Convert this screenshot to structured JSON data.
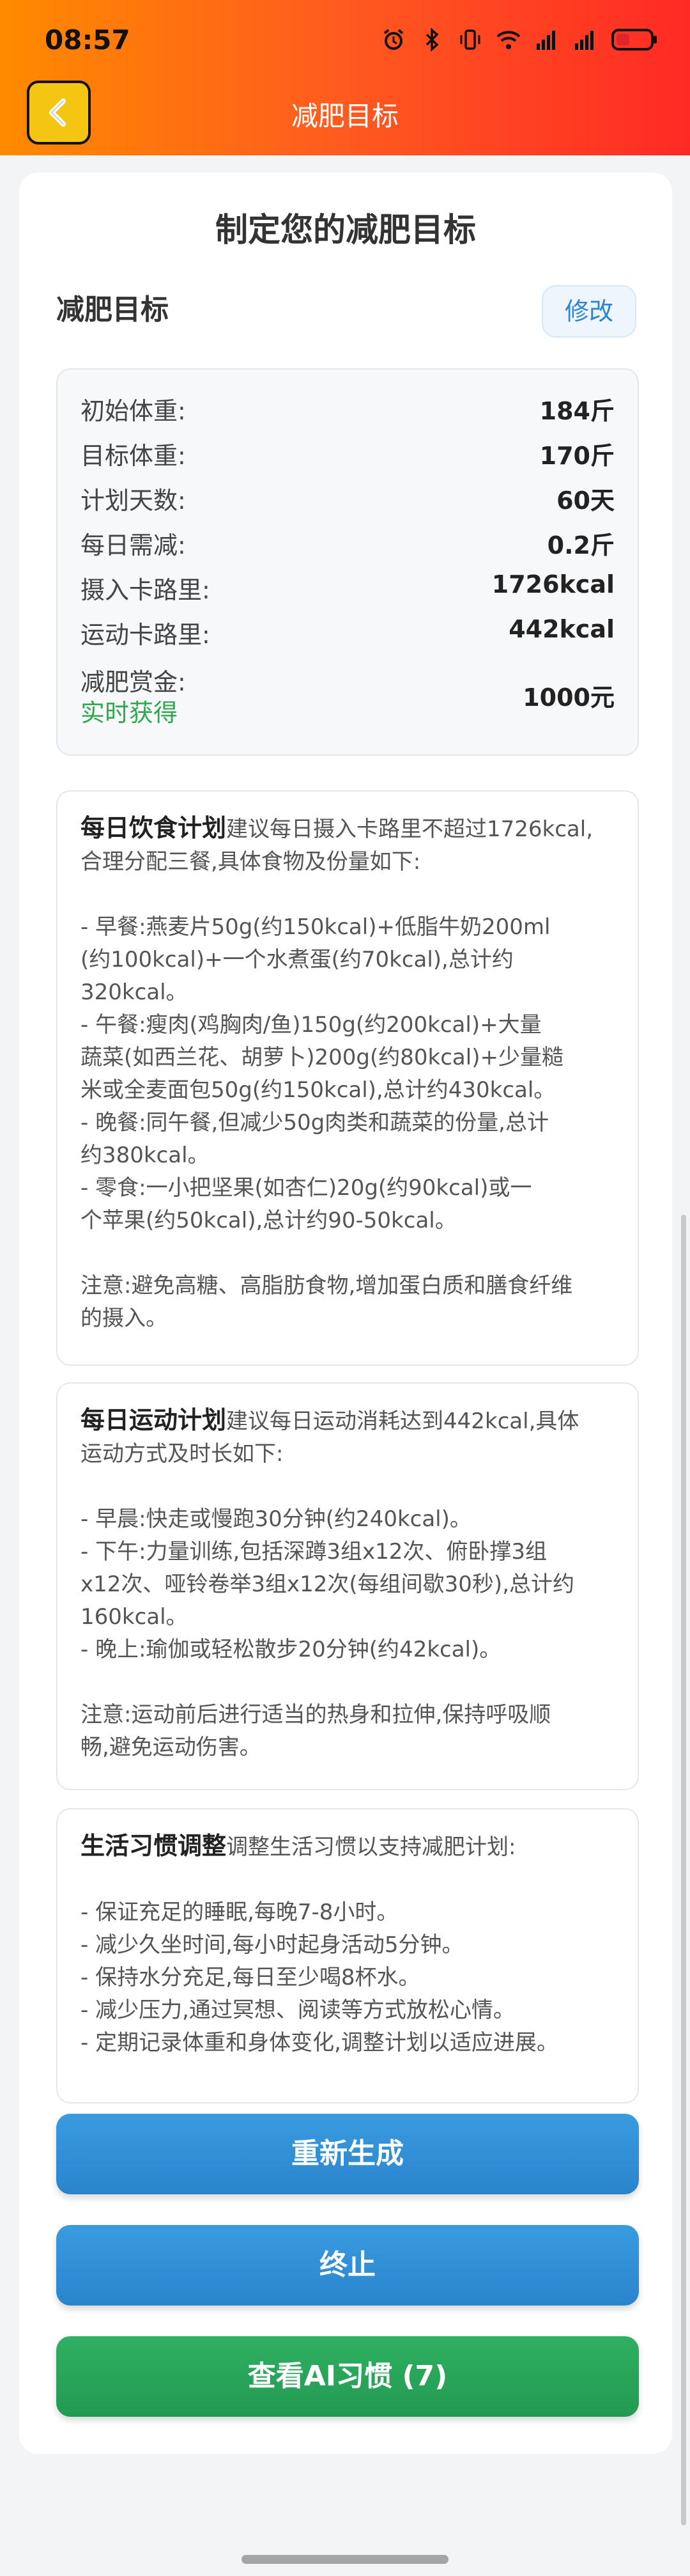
{
  "status_bar": {
    "time": "08:57"
  },
  "header": {
    "title": "减肥目标"
  },
  "card": {
    "title": "制定您的减肥目标",
    "section_title": "减肥目标",
    "edit_label": "修改",
    "stats": [
      {
        "label": "初始体重:",
        "value": "184斤"
      },
      {
        "label": "目标体重:",
        "value": "170斤"
      },
      {
        "label": "计划天数:",
        "value": "60天"
      },
      {
        "label": "每日需减:",
        "value": "0.2斤"
      },
      {
        "label": "摄入卡路里:",
        "value": "1726kcal"
      },
      {
        "label": "运动卡路里:",
        "value": "442kcal"
      },
      {
        "label": "减肥赏金:",
        "value": "1000元",
        "sub": "实时获得"
      }
    ],
    "diet": {
      "heading": "每日饮食计划",
      "intro_1": "建议每日摄入卡路里不超过1726kcal,",
      "intro_2": "合理分配三餐,具体食物及份量如下:",
      "lines": [
        "- 早餐:燕麦片50g(约150kcal)+低脂牛奶200ml",
        "(约100kcal)+一个水煮蛋(约70kcal),总计约",
        "320kcal。",
        "- 午餐:瘦肉(鸡胸肉/鱼)150g(约200kcal)+大量",
        "蔬菜(如西兰花、胡萝卜)200g(约80kcal)+少量糙",
        "米或全麦面包50g(约150kcal),总计约430kcal。",
        "- 晚餐:同午餐,但减少50g肉类和蔬菜的份量,总计",
        "约380kcal。",
        "- 零食:一小把坚果(如杏仁)20g(约90kcal)或一",
        "个苹果(约50kcal),总计约90-50kcal。"
      ],
      "note_1": "注意:避免高糖、高脂肪食物,增加蛋白质和膳食纤维",
      "note_2": "的摄入。"
    },
    "exercise": {
      "heading": "每日运动计划",
      "intro_1": "建议每日运动消耗达到442kcal,具体",
      "intro_2": "运动方式及时长如下:",
      "lines": [
        "- 早晨:快走或慢跑30分钟(约240kcal)。",
        "- 下午:力量训练,包括深蹲3组x12次、俯卧撑3组",
        "x12次、哑铃卷举3组x12次(每组间歇30秒),总计约",
        "160kcal。",
        "- 晚上:瑜伽或轻松散步20分钟(约42kcal)。"
      ],
      "note_1": "注意:运动前后进行适当的热身和拉伸,保持呼吸顺",
      "note_2": "畅,避免运动伤害。"
    },
    "habits": {
      "heading": "生活习惯调整",
      "intro_1": "调整生活习惯以支持减肥计划:",
      "lines": [
        "- 保证充足的睡眠,每晚7-8小时。",
        "- 减少久坐时间,每小时起身活动5分钟。",
        "- 保持水分充足,每日至少喝8杯水。",
        "- 减少压力,通过冥想、阅读等方式放松心情。",
        "- 定期记录体重和身体变化,调整计划以适应进展。"
      ]
    },
    "buttons": {
      "regenerate": "重新生成",
      "stop": "终止",
      "view_habits": "查看AI习惯 (7)"
    }
  },
  "colors": {
    "header_gradient_start": "#ff8a00",
    "header_gradient_end": "#ff2a24",
    "back_button": "#f5c513",
    "accent_blue": "#2b85d0",
    "accent_green": "#2fa84f"
  }
}
